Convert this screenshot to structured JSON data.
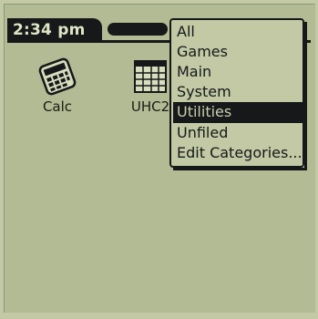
{
  "header": {
    "time": "2:34 pm"
  },
  "apps": [
    {
      "label": "Calc",
      "icon": "calculator-icon"
    },
    {
      "label": "UHC2",
      "icon": "uhc-grid-icon"
    }
  ],
  "category_menu": {
    "items": [
      "All",
      "Games",
      "Main",
      "System",
      "Utilities",
      "Unfiled",
      "Edit Categories..."
    ],
    "selected": "Utilities"
  },
  "colors": {
    "screen": "#b2bb93",
    "ink": "#16181a",
    "menu_bg": "#c2c9a4"
  }
}
